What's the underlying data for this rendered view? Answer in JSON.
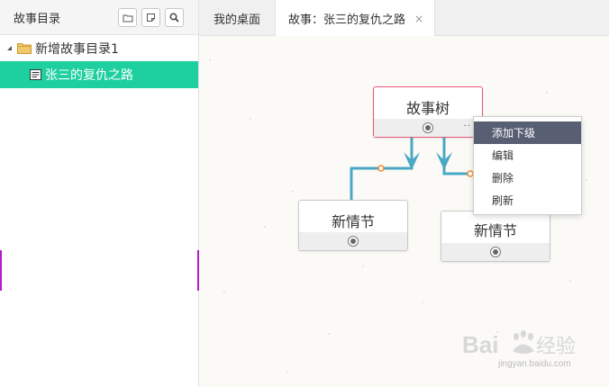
{
  "sidebar": {
    "title": "故事目录",
    "tools": [
      {
        "icon": "folder-icon"
      },
      {
        "icon": "note-icon"
      },
      {
        "icon": "search-icon"
      }
    ],
    "tree": {
      "root_label": "新增故事目录1",
      "child_label": "张三的复仇之路"
    }
  },
  "tabs": [
    {
      "label": "我的桌面",
      "active": false
    },
    {
      "label": "故事：张三的复仇之路",
      "active": true,
      "close": "×"
    }
  ],
  "canvas": {
    "nodes": {
      "root": {
        "label": "故事树",
        "more": "··"
      },
      "child_left": {
        "label": "新情节"
      },
      "child_right": {
        "label": "新情节"
      }
    },
    "link_color": "#4aa8c6",
    "connector_color": "#f08a24"
  },
  "context_menu": {
    "items": [
      "添加下级",
      "编辑",
      "删除",
      "刷新"
    ],
    "active_index": 0
  },
  "watermark": {
    "brand": "Baidu经验",
    "url": "jingyan.baidu.com"
  },
  "colors": {
    "selected_item": "#1ecf9f",
    "accent": "#b31cc9",
    "menu_active": "#595f73",
    "node_selected_border": "#e2577a"
  }
}
